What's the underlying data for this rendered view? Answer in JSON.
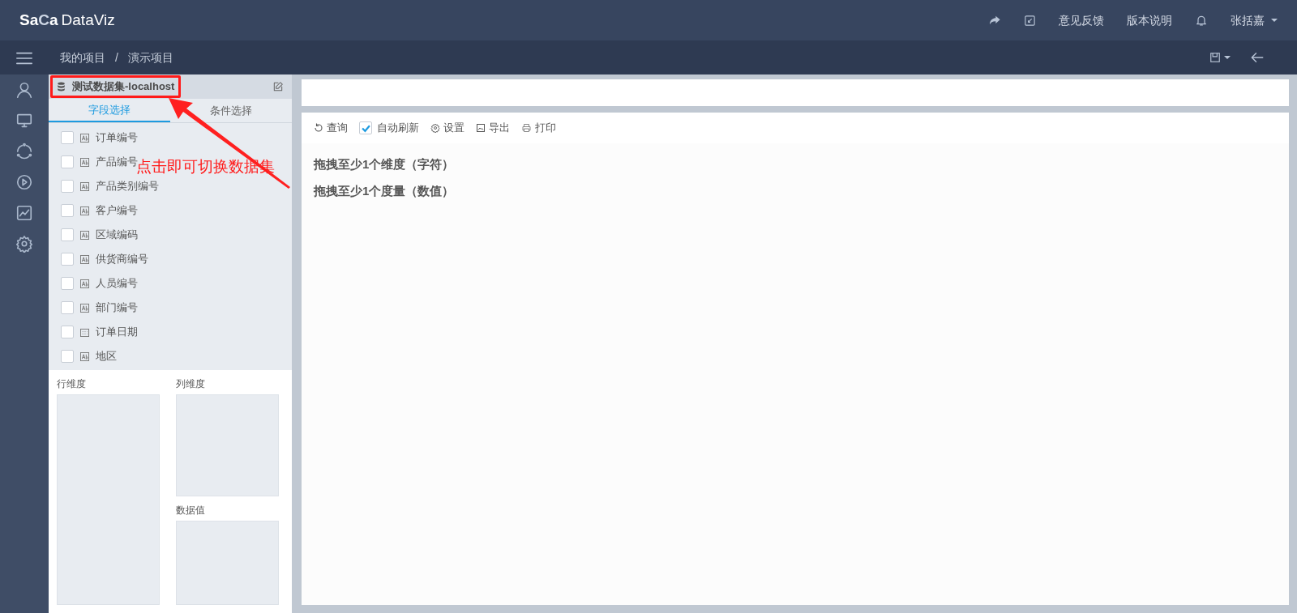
{
  "header": {
    "logo": "Sa",
    "logo_mark": "C",
    "logo_rest": "a",
    "product": "DataViz",
    "links": [
      "意见反馈",
      "版本说明"
    ],
    "user": "张括嘉"
  },
  "breadcrumb": [
    "我的项目",
    "演示项目"
  ],
  "breadcrumb_separator": "/",
  "dataset": {
    "title": "测试数据集-localhost"
  },
  "tabs": [
    {
      "label": "字段选择",
      "selected": true
    },
    {
      "label": "条件选择",
      "selected": false
    }
  ],
  "fields": [
    {
      "label": "订单编号",
      "kind": "text",
      "checked": false
    },
    {
      "label": "产品编号",
      "kind": "text",
      "checked": false
    },
    {
      "label": "产品类别编号",
      "kind": "text",
      "checked": false
    },
    {
      "label": "客户编号",
      "kind": "text",
      "checked": false
    },
    {
      "label": "区域编码",
      "kind": "text",
      "checked": false
    },
    {
      "label": "供货商编号",
      "kind": "text",
      "checked": false
    },
    {
      "label": "人员编号",
      "kind": "text",
      "checked": false
    },
    {
      "label": "部门编号",
      "kind": "text",
      "checked": false
    },
    {
      "label": "订单日期",
      "kind": "date",
      "checked": false
    },
    {
      "label": "地区",
      "kind": "text",
      "checked": false
    }
  ],
  "drop_zones": {
    "rows": "行维度",
    "columns": "列维度",
    "values": "数据值"
  },
  "toolbar": {
    "query": "查询",
    "auto_refresh": {
      "label": "自动刷新",
      "checked": true
    },
    "settings": "设置",
    "export": "导出",
    "print": "打印"
  },
  "messages": [
    "拖拽至少1个维度（字符）",
    "拖拽至少1个度量（数值）"
  ],
  "annotation": {
    "text": "点击即可切换数据集"
  }
}
